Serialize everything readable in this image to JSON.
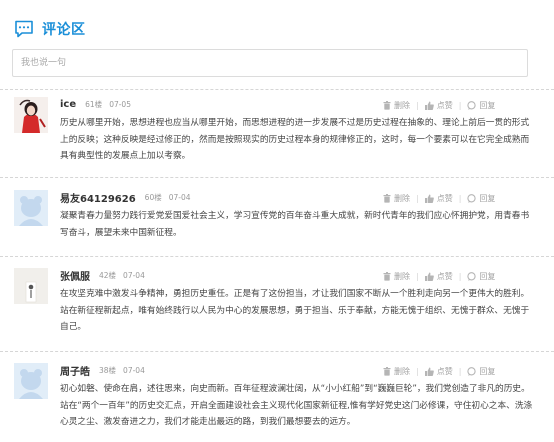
{
  "header": {
    "title": "评论区",
    "icon": "chat-bubble-icon",
    "accent": "#1b8fd8"
  },
  "input": {
    "placeholder": "我也说一句",
    "value": ""
  },
  "actions": {
    "delete": "删除",
    "like": "点赞",
    "reply": "回复"
  },
  "comments": [
    {
      "user": "ice",
      "floor": "61楼",
      "date": "07-05",
      "text": "历史从哪里开始，思想进程也应当从哪里开始，而思想进程的进一步发展不过是历史过程在抽象的、理论上前后一贯的形式上的反映；这种反映是经过修正的，然而是按照现实的历史过程本身的规律修正的，这时，每一个要素可以在它完全成熟而具有典型性的发展点上加以考察。"
    },
    {
      "user": "易友64129626",
      "floor": "60楼",
      "date": "07-04",
      "text": "凝聚青春力量努力践行爱党爱国爱社会主义，学习宣传党的百年奋斗重大成就，新时代青年的我们应心怀拥护党，用青春书写奋斗，展望未来中国新征程。"
    },
    {
      "user": "张佩服",
      "floor": "42楼",
      "date": "07-04",
      "text": "在攻坚克难中激发斗争精神，勇担历史重任。正是有了这份担当，才让我们国家不断从一个胜利走向另一个更伟大的胜利。站在新征程新起点，唯有始终践行以人民为中心的发展思想，勇于担当、乐于奉献，方能无愧于组织、无愧于群众、无愧于自己。"
    },
    {
      "user": "周子皓",
      "floor": "38楼",
      "date": "07-04",
      "text": "初心如磐、使命在肩，述往思来，向史而新。百年征程波澜壮阔，从“小小红船”到“巍巍巨轮”，我们党创造了非凡的历史。站在“两个一百年”的历史交汇点，开启全面建设社会主义现代化国家新征程,惟有学好党史这门必修课，守住初心之本、洗涤心灵之尘、激发奋进之力，我们才能走出最远的路，到我们最想要去的远方。"
    }
  ]
}
